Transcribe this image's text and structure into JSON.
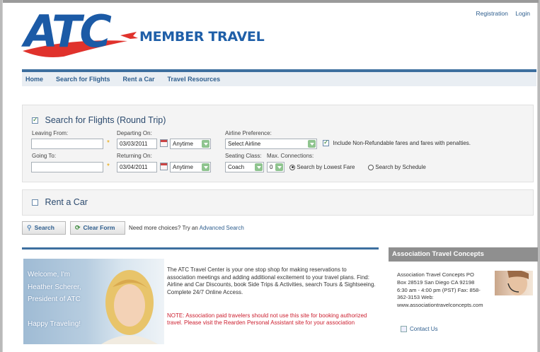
{
  "top_links": {
    "registration": "Registration",
    "login": "Login"
  },
  "logo": {
    "mark": "ATC",
    "tagline": "MEMBER TRAVEL"
  },
  "nav": [
    "Home",
    "Search for Flights",
    "Rent a Car",
    "Travel Resources"
  ],
  "flights": {
    "title": "Search for Flights (Round Trip)",
    "leaving_label": "Leaving From:",
    "leaving_value": "",
    "going_label": "Going To:",
    "going_value": "",
    "departing_label": "Departing On:",
    "departing_date": "03/03/2011",
    "departing_time": "Anytime",
    "returning_label": "Returning On:",
    "returning_date": "03/04/2011",
    "returning_time": "Anytime",
    "airline_label": "Airline Preference:",
    "airline_value": "Select Airline",
    "nonrefundable_label": "Include Non-Refundable fares and fares with penalties.",
    "seating_label": "Seating Class:",
    "seating_value": "Coach",
    "connections_label": "Max. Connections:",
    "connections_value": "0",
    "radio_lowest": "Search by Lowest Fare",
    "radio_schedule": "Search by Schedule"
  },
  "car": {
    "title": "Rent a Car"
  },
  "actions": {
    "search": "Search",
    "clear": "Clear Form",
    "more_text": "Need more choices? Try an",
    "advanced": "Advanced Search"
  },
  "welcome": {
    "photo_lines": [
      "Welcome, I'm",
      "Heather Scherer,",
      "President of ATC",
      "",
      "Happy Traveling!"
    ],
    "intro": "The ATC Travel Center is your one stop shop for making reservations to association meetings and adding additional excitement to your travel plans. Find: Airline and Car Discounts, book Side Trips & Activities, search Tours & Sightseeing. Complete 24/7 Online Access.",
    "note": "NOTE: Association paid travelers should not use this site for booking authorized travel. Please visit the Rearden Personal Assistant site for your association"
  },
  "sidebar": {
    "title": "Association Travel Concepts",
    "lines": [
      "Association Travel Concepts PO",
      "Box 28519 San Diego CA 92198",
      "6:30 am - 4:00 pm (PST) Fax: 858-",
      "362-3153 Web:",
      "www.associationtravelconcepts.com"
    ],
    "contact": "Contact Us"
  },
  "colors": {
    "brand_blue": "#1b5aa6",
    "nav_bar": "#3d6f9f",
    "note_red": "#cc1f2f",
    "sidebar_head": "#8f8f8f"
  }
}
